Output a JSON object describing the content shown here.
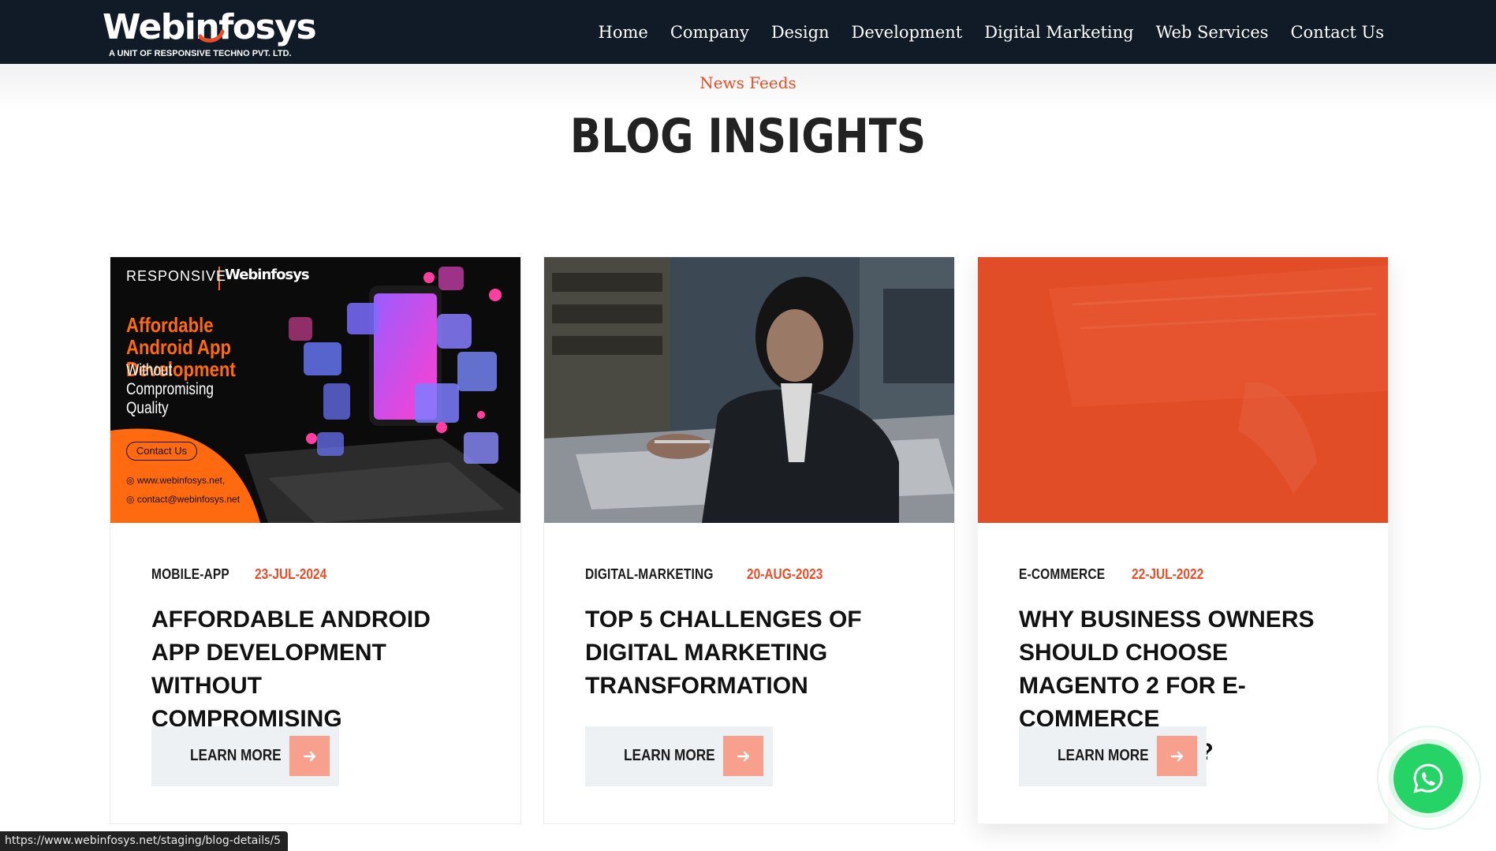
{
  "header": {
    "logo_text": "Webinfosys",
    "logo_subtitle": "A UNIT OF RESPONSIVE TECHNO PVT. LTD.",
    "nav": [
      "Home",
      "Company",
      "Design",
      "Development",
      "Digital Marketing",
      "Web Services",
      "Contact Us"
    ]
  },
  "section": {
    "eyebrow": "News Feeds",
    "title": "BLOG INSIGHTS"
  },
  "cards": [
    {
      "category": "MOBILE-APP",
      "date": "23-JUL-2024",
      "title": "AFFORDABLE ANDROID APP DEVELOPMENT WITHOUT COMPROMISING QUALITY",
      "button": "LEARN MORE",
      "image": {
        "brand": "RESPONSIVE",
        "brand2": "Webinfosys",
        "headline": "Affordable Android App Development",
        "subheadline": "Without Compromising Quality",
        "contact_button": "Contact Us",
        "website": "www.webinfosys.net,",
        "email": "contact@webinfosys.net"
      }
    },
    {
      "category": "DIGITAL-MARKETING",
      "date": "20-AUG-2023",
      "title": "TOP 5 CHALLENGES OF DIGITAL MARKETING TRANSFORMATION",
      "button": "LEARN MORE"
    },
    {
      "category": "E-COMMERCE",
      "date": "22-JUL-2022",
      "title": "WHY BUSINESS OWNERS SHOULD CHOOSE MAGENTO 2 FOR E-COMMERCE DEVELOPMENT?",
      "button": "LEARN MORE"
    }
  ],
  "status_bar": {
    "url": "https://www.webinfosys.net/staging/blog-details/5"
  },
  "colors": {
    "header_bg": "#111a27",
    "accent": "#e84d28",
    "arrow_box": "#f6a08d",
    "button_bg": "#eef1f4",
    "whatsapp": "#25d366"
  },
  "icons": [
    "arrow-right-icon",
    "whatsapp-icon"
  ]
}
